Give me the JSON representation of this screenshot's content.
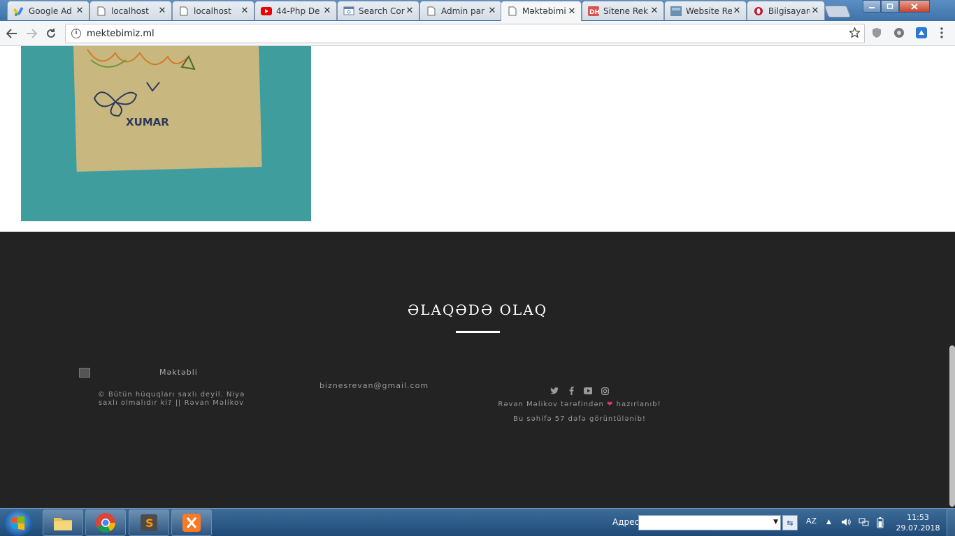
{
  "browser": {
    "tabs": [
      {
        "label": "Google Ad",
        "favicon": "google-ads-icon"
      },
      {
        "label": "localhost",
        "favicon": "page-icon"
      },
      {
        "label": "localhost",
        "favicon": "page-icon"
      },
      {
        "label": "44-Php De",
        "favicon": "youtube-icon"
      },
      {
        "label": "Search Cor",
        "favicon": "search-console-icon"
      },
      {
        "label": "Admin par",
        "favicon": "page-icon"
      },
      {
        "label": "Məktəbimi",
        "favicon": "page-icon"
      },
      {
        "label": "Sitene Rek",
        "favicon": "dh-icon"
      },
      {
        "label": "Website Re",
        "favicon": "website-icon"
      },
      {
        "label": "Bilgisayarc",
        "favicon": "opera-icon"
      }
    ],
    "tab_close_glyph": "✕",
    "url": "mektebimiz.ml"
  },
  "page": {
    "photo_text": "XUMAR",
    "footer": {
      "title": "ƏLAQƏDƏ OLAQ",
      "logo_alt": "Məktəbli",
      "copyright": "© Bütün hüquqları saxlı deyil. Niyə saxlı olmalıdır ki? || Rəvan Məlikov",
      "email": "biznesrevan@gmail.com",
      "made_by_prefix": "Rəvan Məlikov tərəfindən",
      "heart": "❤",
      "made_by_suffix": "hazırlanıb!",
      "views": "Bu səhifə 57 dəfə görüntülənib!"
    }
  },
  "taskbar": {
    "address_label": "Адрес",
    "language": "AZ",
    "time": "11:53",
    "date": "29.07.2018"
  },
  "colors": {
    "footer_bg": "#232323",
    "heart": "#e03a5a",
    "photo_bg": "#3f9d9e"
  }
}
